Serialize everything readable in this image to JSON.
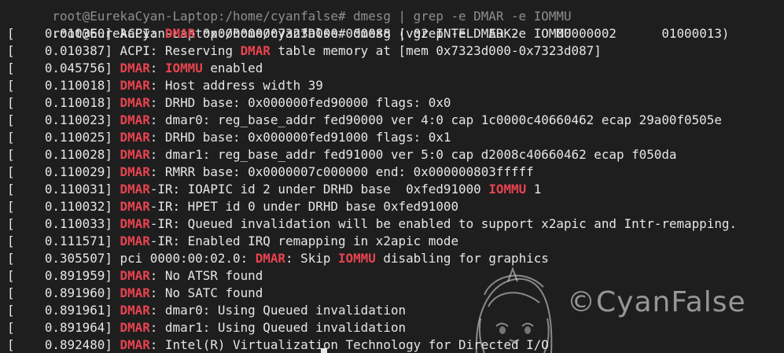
{
  "terminal": {
    "prompt_partial": "root@EurekaCyan-Laptop:/home/cyanfalse# dmesg | grep -e DMAR -e IOMMU",
    "prompt_command": "root@EurekaCyan-Laptop:/home/cyanfalse# dmesg | grep -e DMAR -e IOMMU",
    "lines": [
      [
        {
          "t": "[    0.010360] ACPI: "
        },
        {
          "t": "DMAR",
          "h": true
        },
        {
          "t": " 0x000000007323D000 000088 (v02 INTEL  EDK2     00000002      01000013)"
        }
      ],
      [
        {
          "t": "[    0.010387] ACPI: Reserving "
        },
        {
          "t": "DMAR",
          "h": true
        },
        {
          "t": " table memory at [mem 0x7323d000-0x7323d087]"
        }
      ],
      [
        {
          "t": "[    0.045756] "
        },
        {
          "t": "DMAR",
          "h": true
        },
        {
          "t": ": "
        },
        {
          "t": "IOMMU",
          "h": true
        },
        {
          "t": " enabled"
        }
      ],
      [
        {
          "t": "[    0.110018] "
        },
        {
          "t": "DMAR",
          "h": true
        },
        {
          "t": ": Host address width 39"
        }
      ],
      [
        {
          "t": "[    0.110018] "
        },
        {
          "t": "DMAR",
          "h": true
        },
        {
          "t": ": DRHD base: 0x000000fed90000 flags: 0x0"
        }
      ],
      [
        {
          "t": "[    0.110023] "
        },
        {
          "t": "DMAR",
          "h": true
        },
        {
          "t": ": dmar0: reg_base_addr fed90000 ver 4:0 cap 1c0000c40660462 ecap 29a00f0505e"
        }
      ],
      [
        {
          "t": "[    0.110025] "
        },
        {
          "t": "DMAR",
          "h": true
        },
        {
          "t": ": DRHD base: 0x000000fed91000 flags: 0x1"
        }
      ],
      [
        {
          "t": "[    0.110028] "
        },
        {
          "t": "DMAR",
          "h": true
        },
        {
          "t": ": dmar1: reg_base_addr fed91000 ver 5:0 cap d2008c40660462 ecap f050da"
        }
      ],
      [
        {
          "t": "[    0.110029] "
        },
        {
          "t": "DMAR",
          "h": true
        },
        {
          "t": ": RMRR base: 0x0000007c000000 end: 0x000000803fffff"
        }
      ],
      [
        {
          "t": "[    0.110031] "
        },
        {
          "t": "DMAR",
          "h": true
        },
        {
          "t": "-IR: IOAPIC id 2 under DRHD base  0xfed91000 "
        },
        {
          "t": "IOMMU",
          "h": true
        },
        {
          "t": " 1"
        }
      ],
      [
        {
          "t": "[    0.110032] "
        },
        {
          "t": "DMAR",
          "h": true
        },
        {
          "t": "-IR: HPET id 0 under DRHD base 0xfed91000"
        }
      ],
      [
        {
          "t": "[    0.110033] "
        },
        {
          "t": "DMAR",
          "h": true
        },
        {
          "t": "-IR: Queued invalidation will be enabled to support x2apic and Intr-remapping."
        }
      ],
      [
        {
          "t": "[    0.111571] "
        },
        {
          "t": "DMAR",
          "h": true
        },
        {
          "t": "-IR: Enabled IRQ remapping in x2apic mode"
        }
      ],
      [
        {
          "t": "[    0.305507] pci 0000:00:02.0: "
        },
        {
          "t": "DMAR",
          "h": true
        },
        {
          "t": ": Skip "
        },
        {
          "t": "IOMMU",
          "h": true
        },
        {
          "t": " disabling for graphics"
        }
      ],
      [
        {
          "t": "[    0.891959] "
        },
        {
          "t": "DMAR",
          "h": true
        },
        {
          "t": ": No ATSR found"
        }
      ],
      [
        {
          "t": "[    0.891960] "
        },
        {
          "t": "DMAR",
          "h": true
        },
        {
          "t": ": No SATC found"
        }
      ],
      [
        {
          "t": "[    0.891961] "
        },
        {
          "t": "DMAR",
          "h": true
        },
        {
          "t": ": dmar0: Using Queued invalidation"
        }
      ],
      [
        {
          "t": "[    0.891964] "
        },
        {
          "t": "DMAR",
          "h": true
        },
        {
          "t": ": dmar1: Using Queued invalidation"
        }
      ],
      [
        {
          "t": "[    0.892480] "
        },
        {
          "t": "DMAR",
          "h": true
        },
        {
          "t": ": Intel(R) Virtualization Technology for Directed I/O"
        }
      ]
    ]
  },
  "watermark": {
    "text": "©CyanFalse",
    "icon": "anime-avatar-icon"
  },
  "colors": {
    "background": "#1e1e1e",
    "foreground": "#e6e6e6",
    "highlight": "#e8434f"
  }
}
